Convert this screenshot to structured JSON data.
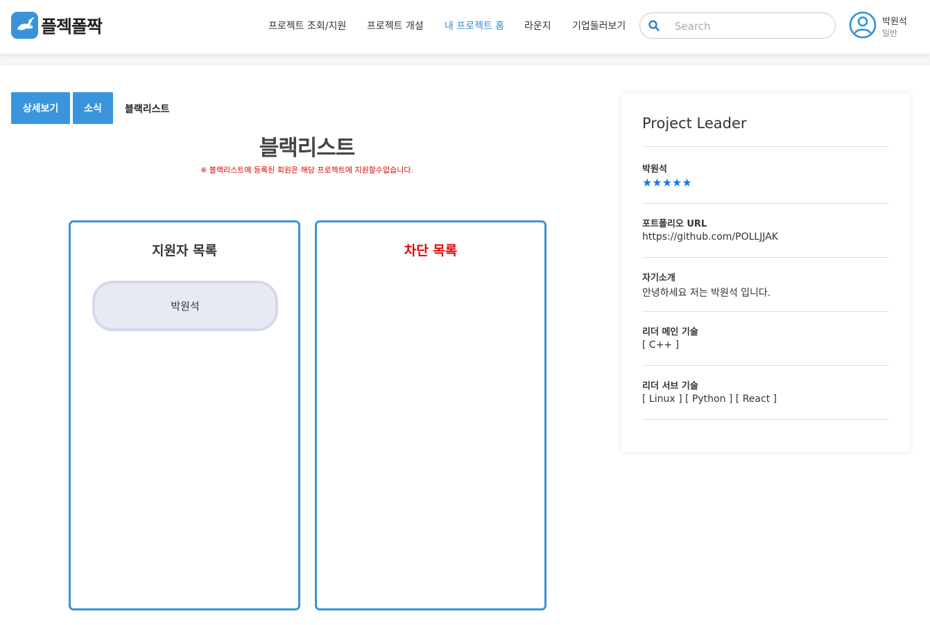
{
  "header": {
    "logo_text": "플젝폴짝",
    "nav": [
      {
        "label": "프로젝트 조회/지원",
        "active": false
      },
      {
        "label": "프로젝트 개설",
        "active": false
      },
      {
        "label": "내 프로젝트 홈",
        "active": true
      },
      {
        "label": "라운지",
        "active": false
      },
      {
        "label": "기업둘러보기",
        "active": false
      }
    ],
    "search_placeholder": "Search",
    "user_name": "박원석",
    "user_role": "일반"
  },
  "tabs": {
    "detail": "상세보기",
    "news": "소식",
    "blacklist": "블랙리스트"
  },
  "main": {
    "title": "블랙리스트",
    "notice": "※ 블랙리스트에 등록된 회원은 해당 프로젝트에 지원할수없습니다."
  },
  "applicants_panel": {
    "title": "지원자 목록",
    "items": [
      "박원석"
    ]
  },
  "blocked_panel": {
    "title": "차단 목록",
    "items": []
  },
  "leader_card": {
    "title": "Project Leader",
    "name": "박원석",
    "rating_stars": "★★★★★",
    "rating": 5,
    "portfolio_label": "포트폴리오 URL",
    "portfolio_value": "https://github.com/POLLJJAK",
    "intro_label": "자기소개",
    "intro_value": "안녕하세요 저는 박원석 입니다.",
    "main_skill_label": "리더 메인 기술",
    "main_skill_value": "[ C++ ]",
    "sub_skill_label": "리더 서브 기술",
    "sub_skill_value": "[ Linux ] [ Python ] [ React ]"
  },
  "colors": {
    "accent": "#3a96dc",
    "active_nav": "#2f8fd8",
    "warning": "#e00000",
    "star": "#1577e8"
  },
  "icons": {
    "logo": "rabbit-icon",
    "search": "search-icon",
    "avatar": "user-avatar-icon"
  }
}
